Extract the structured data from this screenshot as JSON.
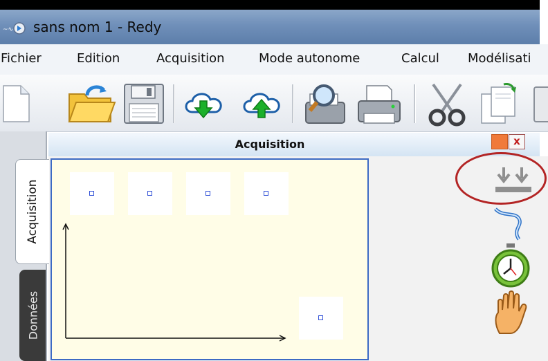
{
  "window": {
    "title": "sans nom 1 - Redy"
  },
  "menu": {
    "items": [
      "Fichier",
      "Edition",
      "Acquisition",
      "Mode autonome",
      "Calcul",
      "Modélisati"
    ]
  },
  "toolbar": {
    "icons": [
      "new-document-icon",
      "open-folder-icon",
      "save-floppy-icon",
      "cloud-download-icon",
      "cloud-upload-icon",
      "print-preview-icon",
      "printer-icon",
      "cut-scissors-icon",
      "copy-icon",
      "paste-icon"
    ]
  },
  "left_tabs": {
    "acquisition": "Acquisition",
    "donnees": "Données"
  },
  "panel": {
    "title": "Acquisition",
    "close_label": "x"
  },
  "side_tools": {
    "icons": [
      "trigger-down-arrows-icon",
      "manual-trigger-hand-icon",
      "stopwatch-icon",
      "stop-hand-icon"
    ],
    "highlight_color": "#b32424"
  },
  "colors": {
    "graph_background": "#fffde7",
    "graph_border": "#3c6ac4",
    "panel_close": "#c01818",
    "panel_restore": "#f07a3a"
  }
}
